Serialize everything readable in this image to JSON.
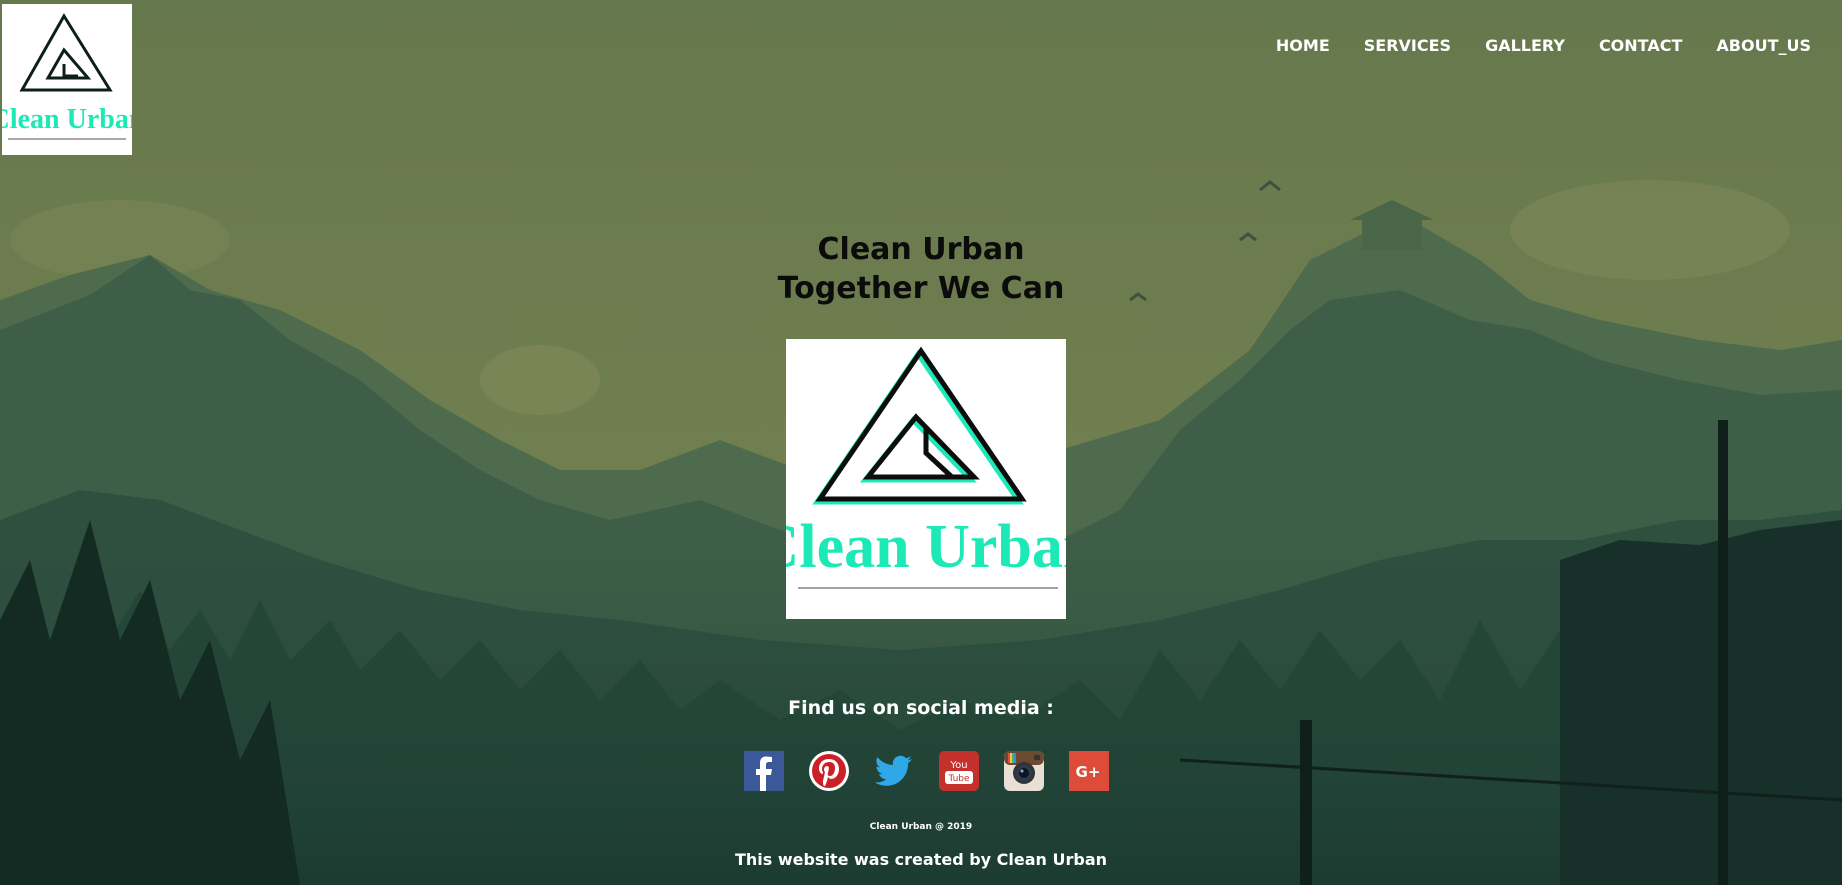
{
  "header": {
    "logo_text": "Clean Urban",
    "nav": [
      {
        "label": "HOME"
      },
      {
        "label": "SERVICES"
      },
      {
        "label": "GALLERY"
      },
      {
        "label": "CONTACT"
      },
      {
        "label": "ABOUT_US"
      }
    ]
  },
  "hero": {
    "title_line1": "Clean Urban",
    "title_line2": "Together We Can",
    "logo_text": "Clean Urban"
  },
  "social": {
    "heading": "Find us on social media :",
    "icons": [
      "facebook-icon",
      "pinterest-icon",
      "twitter-icon",
      "youtube-icon",
      "instagram-icon",
      "google-plus-icon"
    ]
  },
  "footer": {
    "copyright": "Clean Urban @ 2019",
    "credit": "This website was created by Clean Urban"
  },
  "colors": {
    "brand_teal": "#1de9b6",
    "sky": "#6a7a4e",
    "mountain_far": "#4e6a4c",
    "forest_dark": "#1f3a30"
  }
}
